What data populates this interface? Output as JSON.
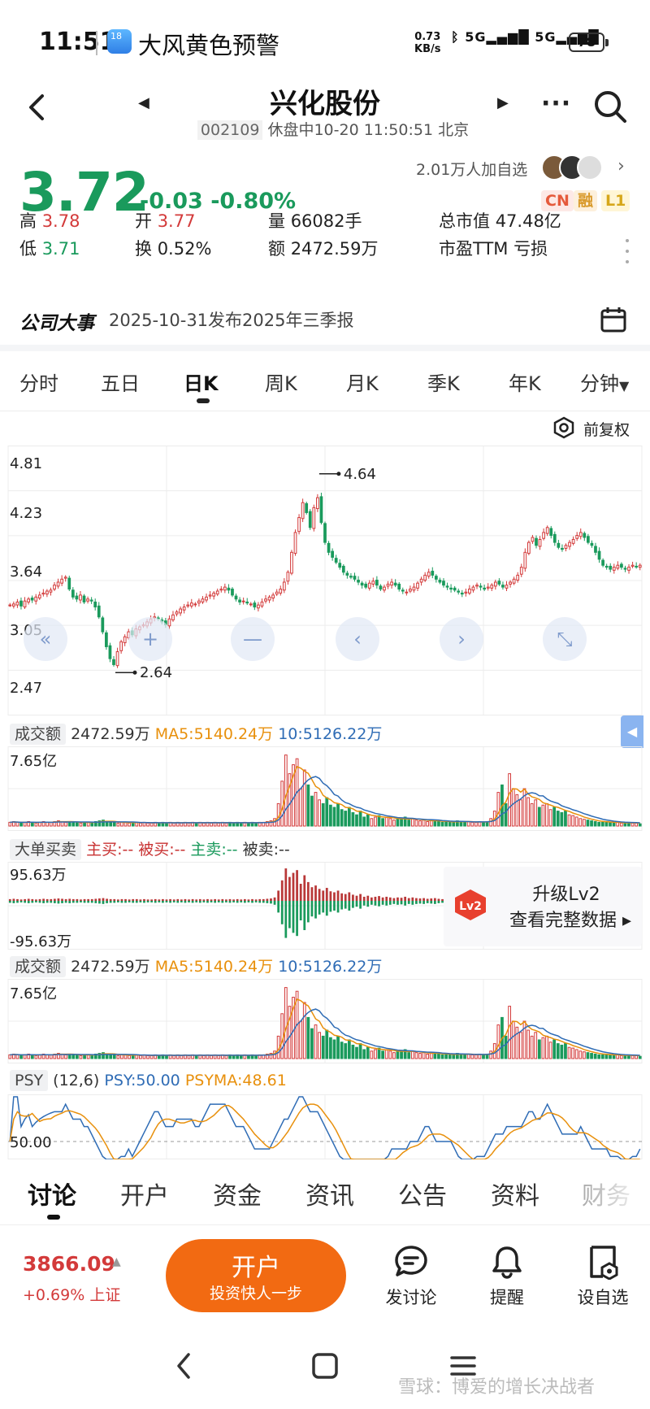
{
  "status_bar": {
    "time": "11:51",
    "app_badge": "18",
    "alert": "大风黄色预警",
    "speed_value": "0.73",
    "speed_unit": "KB/s",
    "net1": "5G",
    "net2": "5G",
    "battery": "78"
  },
  "header": {
    "title": "兴化股份",
    "code": "002109",
    "status": "休盘中10-20 11:50:51 北京"
  },
  "quote": {
    "price": "3.72",
    "change": "-0.03 -0.80%",
    "watchers": "2.01万人加自选",
    "tags": [
      "CN",
      "融",
      "L1"
    ],
    "stats": [
      {
        "label": "高",
        "value": "3.78",
        "tone": "red"
      },
      {
        "label": "开",
        "value": "3.77",
        "tone": "red"
      },
      {
        "label": "量",
        "value": "66082手",
        "tone": "dark"
      },
      {
        "label": "总市值",
        "value": "47.48亿",
        "tone": "dark"
      },
      {
        "label": "低",
        "value": "3.71",
        "tone": "green"
      },
      {
        "label": "换",
        "value": "0.52%",
        "tone": "dark"
      },
      {
        "label": "额",
        "value": "2472.59万",
        "tone": "dark"
      },
      {
        "label": "市盈TTM",
        "value": "亏损",
        "tone": "dark"
      }
    ]
  },
  "event": {
    "title": "公司大事",
    "text": "2025-10-31发布2025年三季报"
  },
  "kline_tabs": [
    "分时",
    "五日",
    "日K",
    "周K",
    "月K",
    "季K",
    "年K",
    "分钟"
  ],
  "adjust_label": "前复权",
  "chart_data": [
    {
      "type": "candlestick",
      "title": "",
      "y_ticks": [
        "4.81",
        "4.23",
        "3.64",
        "3.05",
        "2.47"
      ],
      "ylim": [
        2.47,
        4.81
      ],
      "annotations": [
        {
          "text": "4.64",
          "value": 4.64
        },
        {
          "text": "2.64",
          "value": 2.64
        }
      ],
      "close": [
        3.32,
        3.33,
        3.35,
        3.31,
        3.36,
        3.38,
        3.37,
        3.4,
        3.42,
        3.44,
        3.46,
        3.47,
        3.52,
        3.55,
        3.58,
        3.6,
        3.48,
        3.4,
        3.38,
        3.42,
        3.35,
        3.38,
        3.36,
        3.3,
        3.2,
        3.05,
        2.9,
        2.78,
        2.72,
        2.85,
        2.95,
        3.0,
        3.05,
        3.02,
        3.08,
        3.1,
        3.12,
        3.15,
        3.18,
        3.2,
        3.18,
        3.15,
        3.12,
        3.18,
        3.22,
        3.25,
        3.28,
        3.3,
        3.32,
        3.34,
        3.33,
        3.36,
        3.38,
        3.4,
        3.42,
        3.44,
        3.46,
        3.48,
        3.5,
        3.47,
        3.42,
        3.38,
        3.35,
        3.36,
        3.34,
        3.33,
        3.3,
        3.32,
        3.35,
        3.38,
        3.4,
        3.42,
        3.45,
        3.48,
        3.55,
        3.65,
        3.85,
        4.05,
        4.2,
        4.35,
        4.25,
        4.1,
        4.3,
        4.4,
        4.15,
        3.95,
        3.85,
        3.8,
        3.75,
        3.7,
        3.65,
        3.62,
        3.6,
        3.58,
        3.55,
        3.52,
        3.5,
        3.54,
        3.56,
        3.52,
        3.48,
        3.5,
        3.53,
        3.55,
        3.52,
        3.48,
        3.46,
        3.45,
        3.48,
        3.5,
        3.54,
        3.58,
        3.62,
        3.65,
        3.62,
        3.58,
        3.55,
        3.52,
        3.5,
        3.48,
        3.47,
        3.45,
        3.43,
        3.45,
        3.48,
        3.5,
        3.52,
        3.5,
        3.48,
        3.5,
        3.52,
        3.55,
        3.53,
        3.5,
        3.52,
        3.55,
        3.58,
        3.62,
        3.7,
        3.85,
        3.95,
        4.0,
        3.92,
        3.98,
        4.05,
        4.1,
        4.02,
        3.95,
        3.9,
        3.88,
        3.92,
        3.95,
        3.98,
        4.02,
        4.05,
        4.0,
        3.95,
        3.92,
        3.85,
        3.78,
        3.72,
        3.7,
        3.68,
        3.7,
        3.72,
        3.7,
        3.68,
        3.7,
        3.72,
        3.71,
        3.72
      ]
    },
    {
      "type": "bar",
      "title": "成交额",
      "series_labels": [
        "2472.59万",
        "MA5:5140.24万",
        "10:5126.22万"
      ],
      "y_max_label": "7.65亿",
      "values_top": [
        0.05,
        0.06,
        0.05,
        0.04,
        0.05,
        0.06,
        0.05,
        0.04,
        0.05,
        0.06,
        0.05,
        0.05,
        0.06,
        0.07,
        0.06,
        0.05,
        0.06,
        0.05,
        0.05,
        0.04,
        0.05,
        0.05,
        0.05,
        0.06,
        0.07,
        0.08,
        0.06,
        0.05,
        0.05,
        0.04,
        0.05,
        0.05,
        0.04,
        0.05,
        0.05,
        0.04,
        0.05,
        0.04,
        0.04,
        0.05,
        0.04,
        0.05,
        0.04,
        0.05,
        0.04,
        0.05,
        0.04,
        0.05,
        0.04,
        0.05,
        0.04,
        0.05,
        0.04,
        0.05,
        0.04,
        0.05,
        0.04,
        0.05,
        0.04,
        0.05,
        0.04,
        0.05,
        0.04,
        0.05,
        0.04,
        0.05,
        0.04,
        0.05,
        0.05,
        0.06,
        0.07,
        0.1,
        0.3,
        0.6,
        0.95,
        0.7,
        0.82,
        0.9,
        0.5,
        0.75,
        0.55,
        0.4,
        0.45,
        0.35,
        0.3,
        0.38,
        0.28,
        0.25,
        0.3,
        0.22,
        0.2,
        0.25,
        0.18,
        0.15,
        0.2,
        0.12,
        0.15,
        0.1,
        0.12,
        0.14,
        0.1,
        0.12,
        0.1,
        0.08,
        0.1,
        0.09,
        0.12,
        0.08,
        0.1,
        0.08,
        0.07,
        0.08,
        0.06,
        0.07,
        0.08,
        0.06,
        0.05,
        0.06,
        0.05,
        0.06,
        0.07,
        0.06,
        0.05,
        0.06,
        0.05,
        0.05,
        0.06,
        0.05,
        0.06,
        0.1,
        0.2,
        0.45,
        0.55,
        0.3,
        0.7,
        0.5,
        0.42,
        0.35,
        0.5,
        0.38,
        0.3,
        0.35,
        0.25,
        0.28,
        0.3,
        0.22,
        0.25,
        0.2,
        0.18,
        0.2,
        0.15,
        0.14,
        0.12,
        0.1,
        0.09,
        0.08,
        0.07,
        0.06,
        0.05,
        0.05,
        0.06,
        0.05,
        0.04,
        0.05,
        0.04,
        0.04,
        0.05,
        0.04,
        0.04,
        0.03
      ]
    },
    {
      "type": "bar",
      "title": "大单买卖",
      "series_labels": [
        "主买:--",
        "被买:--",
        "主卖:--",
        "被卖:--"
      ],
      "y_max_label": "95.63万",
      "y_min_label": "-95.63万"
    },
    {
      "type": "bar",
      "title": "成交额",
      "series_labels": [
        "2472.59万",
        "MA5:5140.24万",
        "10:5126.22万"
      ],
      "y_max_label": "7.65亿"
    },
    {
      "type": "line",
      "title": "PSY",
      "params": "(12,6)",
      "series_labels": [
        "PSY:50.00",
        "PSYMA:48.61"
      ],
      "ref_label": "50.00"
    }
  ],
  "lv2_promo": {
    "badge": "Lv2",
    "line1": "升级Lv2",
    "line2": "查看完整数据 ▸"
  },
  "bottom_tabs": [
    "讨论",
    "开户",
    "资金",
    "资讯",
    "公告",
    "资料",
    "财务"
  ],
  "index": {
    "value": "3866.09",
    "change": "+0.69% 上证"
  },
  "open_button": {
    "title": "开户",
    "subtitle": "投资快人一步"
  },
  "actions": [
    {
      "label": "发讨论",
      "icon": "chat-icon"
    },
    {
      "label": "提醒",
      "icon": "bell-icon"
    },
    {
      "label": "设自选",
      "icon": "add-watchlist-icon"
    }
  ],
  "watermark": "雪球：博爱的增长决战者",
  "colors": {
    "up": "#d33a3a",
    "down": "#1a9a5c",
    "accent": "#f26a12",
    "ma5": "#e8900c",
    "ma10": "#2f6cb5"
  }
}
